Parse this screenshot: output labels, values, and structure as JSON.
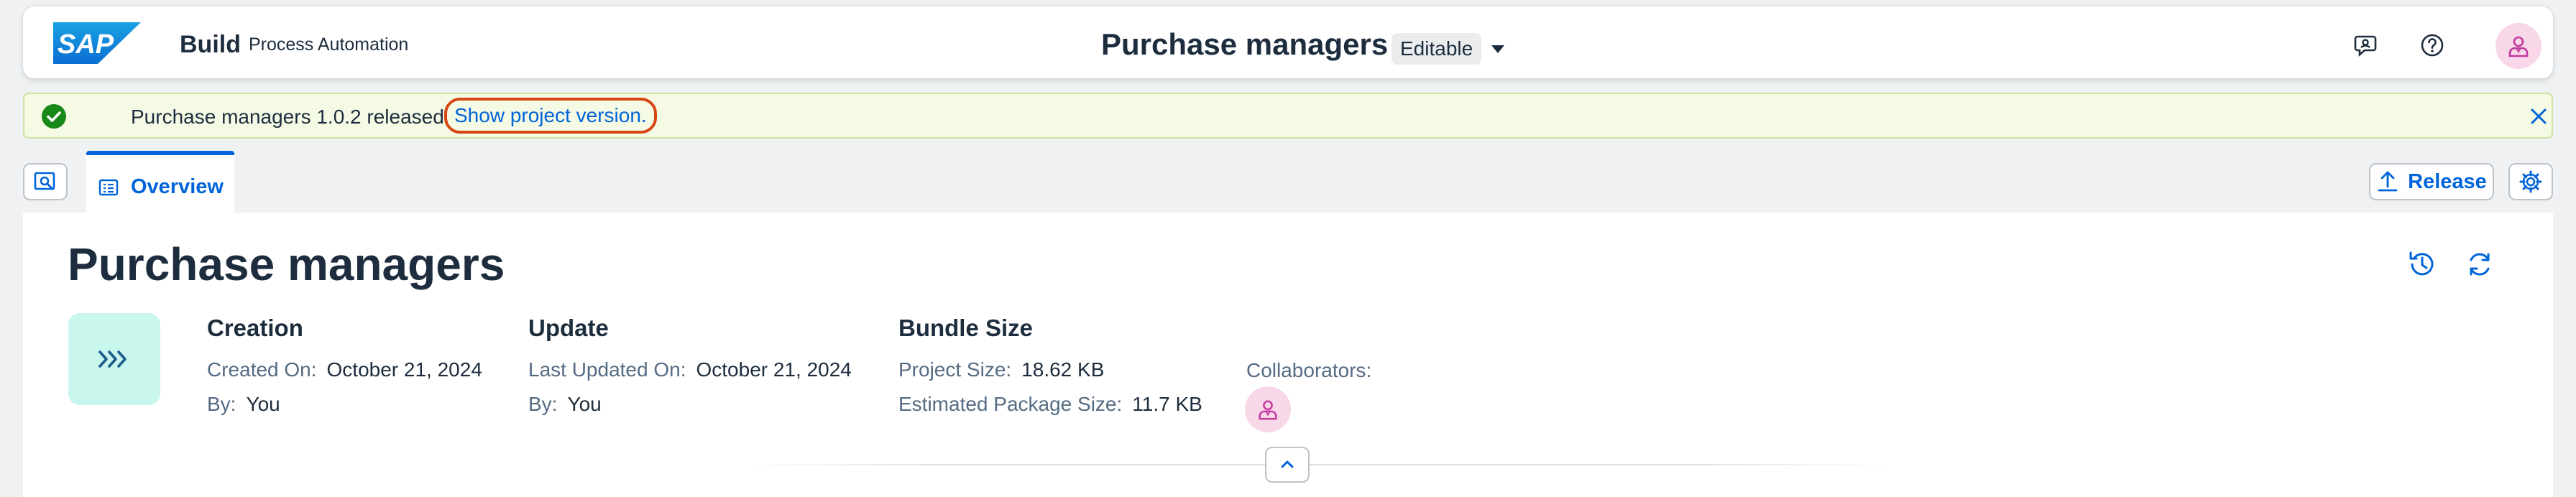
{
  "shell": {
    "logo_text": "SAP",
    "product": "Build",
    "subproduct": "Process Automation",
    "title": "Purchase managers",
    "mode_badge": "Editable",
    "icons": [
      "feedback-icon",
      "help-icon",
      "user-avatar-icon"
    ]
  },
  "message": {
    "text": "Purchase managers 1.0.2 released.",
    "link": "Show project version."
  },
  "tabs": [
    {
      "label": "Overview",
      "selected": true
    }
  ],
  "toolbar": {
    "release_label": "Release"
  },
  "project": {
    "title": "Purchase managers",
    "creation": {
      "heading": "Creation",
      "created_on_label": "Created On:",
      "created_on": "October 21, 2024",
      "by_label": "By:",
      "by": "You"
    },
    "update": {
      "heading": "Update",
      "last_updated_label": "Last Updated On:",
      "last_updated": "October 21, 2024",
      "by_label": "By:",
      "by": "You"
    },
    "bundle": {
      "heading": "Bundle Size",
      "project_size_label": "Project Size:",
      "project_size": "18.62 KB",
      "package_size_label": "Estimated Package Size:",
      "package_size": "11.7 KB"
    },
    "collaborators_label": "Collaborators:"
  },
  "colors": {
    "brand_blue": "#0064d9",
    "text": "#1d2d3e",
    "success": "#188918",
    "highlight_ring": "#d64612",
    "tile_bg": "#c9f7ee",
    "avatar_bg": "#f8d7e8"
  }
}
